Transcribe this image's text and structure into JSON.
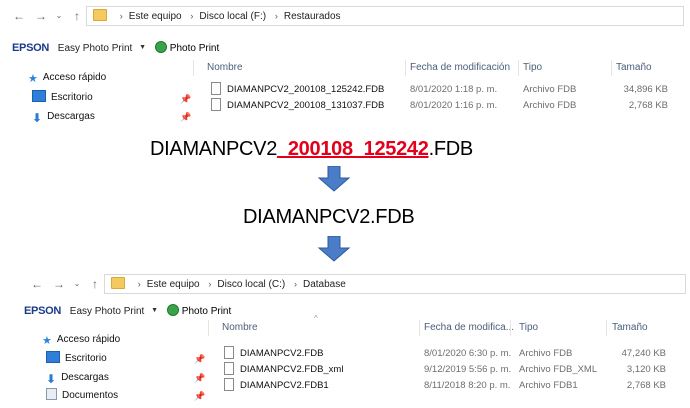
{
  "top_window": {
    "breadcrumb": [
      "Este equipo",
      "Disco local (F:)",
      "Restaurados"
    ],
    "toolbar": {
      "brand": "EPSON",
      "easy_photo_print": "Easy Photo Print",
      "photo_print": "Photo Print"
    },
    "nav": [
      {
        "label": "Acceso rápido",
        "icon": "star-icon"
      },
      {
        "label": "Escritorio",
        "icon": "desktop-icon"
      },
      {
        "label": "Descargas",
        "icon": "download-icon"
      }
    ],
    "columns": {
      "name": "Nombre",
      "date": "Fecha de modificación",
      "type": "Tipo",
      "size": "Tamaño"
    },
    "files": [
      {
        "name": "DIAMANPCV2_200108_125242.FDB",
        "date": "8/01/2020 1:18 p. m.",
        "type": "Archivo FDB",
        "size": "34,896 KB"
      },
      {
        "name": "DIAMANPCV2_200108_131037.FDB",
        "date": "8/01/2020 1:16 p. m.",
        "type": "Archivo FDB",
        "size": "2,768 KB"
      }
    ]
  },
  "annotation": {
    "line1_prefix": "DIAMANPCV2",
    "line1_highlight": "_200108_125242",
    "line1_suffix": ".FDB",
    "line2": "DIAMANPCV2.FDB",
    "arrow_color": "#4a7cc7"
  },
  "bottom_window": {
    "breadcrumb": [
      "Este equipo",
      "Disco local (C:)",
      "Database"
    ],
    "toolbar": {
      "brand": "EPSON",
      "easy_photo_print": "Easy Photo Print",
      "photo_print": "Photo Print"
    },
    "nav": [
      {
        "label": "Acceso rápido",
        "icon": "star-icon"
      },
      {
        "label": "Escritorio",
        "icon": "desktop-icon"
      },
      {
        "label": "Descargas",
        "icon": "download-icon"
      },
      {
        "label": "Documentos",
        "icon": "documents-icon"
      }
    ],
    "columns": {
      "name": "Nombre",
      "date": "Fecha de modifica...",
      "type": "Tipo",
      "size": "Tamaño"
    },
    "files": [
      {
        "name": "DIAMANPCV2.FDB",
        "date": "8/01/2020 6:30 p. m.",
        "type": "Archivo FDB",
        "size": "47,240 KB"
      },
      {
        "name": "DIAMANPCV2.FDB_xml",
        "date": "9/12/2019 5:56 p. m.",
        "type": "Archivo FDB_XML",
        "size": "3,120 KB"
      },
      {
        "name": "DIAMANPCV2.FDB1",
        "date": "8/11/2018 8:20 p. m.",
        "type": "Archivo FDB1",
        "size": "2,768 KB"
      }
    ]
  }
}
